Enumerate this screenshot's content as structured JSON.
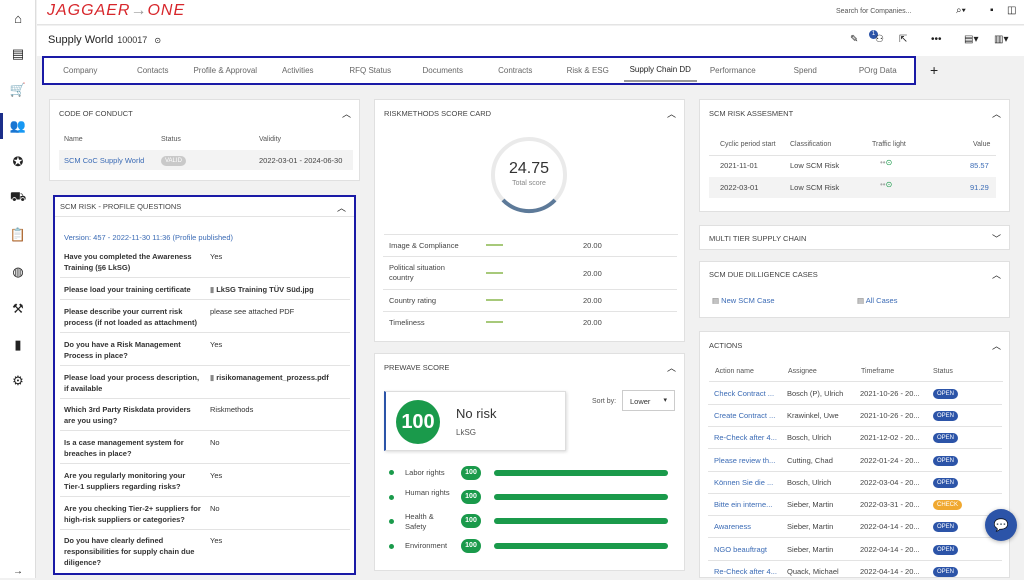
{
  "app": {
    "logo_left": "JAGGAER",
    "logo_right": "ONE"
  },
  "search": {
    "placeholder": "Search for Companies..."
  },
  "header": {
    "title": "Supply World",
    "id": "100017",
    "notif_count": "1"
  },
  "tabs": [
    {
      "label": "Company"
    },
    {
      "label": "Contacts"
    },
    {
      "label": "Profile & Approval"
    },
    {
      "label": "Activities"
    },
    {
      "label": "RFQ Status"
    },
    {
      "label": "Documents"
    },
    {
      "label": "Contracts"
    },
    {
      "label": "Risk & ESG"
    },
    {
      "label": "Supply Chain DD"
    },
    {
      "label": "Performance"
    },
    {
      "label": "Spend"
    },
    {
      "label": "POrg Data"
    }
  ],
  "conduct": {
    "title": "CODE OF CONDUCT",
    "cols": [
      "Name",
      "Status",
      "Validity"
    ],
    "row": {
      "name": "SCM CoC Supply World",
      "status": "VALID",
      "validity": "2022-03-01 - 2024-06-30"
    }
  },
  "profile": {
    "title": "SCM RISK - PROFILE QUESTIONS",
    "version": "Version: 457 - 2022-11-30 11:36 (Profile published)",
    "qa": [
      {
        "q": "Have you completed the Awareness Training (§6 LkSG)",
        "a": "Yes"
      },
      {
        "q": "Please load your training certificate",
        "a": "LkSG Training TÜV Süd.jpg"
      },
      {
        "q": "Please describe your current risk process (if not loaded as attachment)",
        "a": "please see attached PDF"
      },
      {
        "q": "Do you have a Risk Management Process in place?",
        "a": "Yes"
      },
      {
        "q": "Please load your process description, if available",
        "a": "risikomanagement_prozess.pdf"
      },
      {
        "q": "Which 3rd Party Riskdata providers are you using?",
        "a": "Riskmethods"
      },
      {
        "q": "Is a case management system for breaches in place?",
        "a": "No"
      },
      {
        "q": "Are you regularly monitoring your Tier-1 suppliers regarding risks?",
        "a": "Yes"
      },
      {
        "q": "Are you checking Tier-2+ suppliers for high-risk suppliers or categories?",
        "a": "No"
      },
      {
        "q": "Do you have clearly defined responsibilities for supply chain due diligence?",
        "a": "Yes"
      }
    ]
  },
  "riskmethods": {
    "title": "RISKMETHODS SCORE CARD",
    "score": "24.75",
    "score_label": "Total score",
    "rows": [
      {
        "label": "Image & Compliance",
        "value": "20.00"
      },
      {
        "label": "Political situation country",
        "value": "20.00"
      },
      {
        "label": "Country rating",
        "value": "20.00"
      },
      {
        "label": "Timeliness",
        "value": "20.00"
      }
    ]
  },
  "prewave": {
    "title": "PREWAVE SCORE",
    "score": "100",
    "risk": "No risk",
    "sub": "LkSG",
    "sort_label": "Sort by:",
    "sort_value": "Lower",
    "rows": [
      {
        "label": "Labor rights",
        "value": "100",
        "pct": 1.0
      },
      {
        "label": "Human rights",
        "value": "100",
        "pct": 1.0
      },
      {
        "label": "Health & Safety",
        "value": "100",
        "pct": 1.0
      },
      {
        "label": "Environment",
        "value": "100",
        "pct": 1.0
      }
    ]
  },
  "scm_risk": {
    "title": "SCM RISK ASSESMENT",
    "cols": [
      "Cyclic period start",
      "Classification",
      "Traffic light",
      "Value"
    ],
    "rows": [
      {
        "start": "2021-11-01",
        "class": "Low SCM Risk",
        "value": "85.57"
      },
      {
        "start": "2022-03-01",
        "class": "Low SCM Risk",
        "value": "91.29"
      }
    ]
  },
  "multitier": {
    "title": "MULTI TIER SUPPLY CHAIN"
  },
  "duecases": {
    "title": "SCM DUE DILLIGENCE CASES",
    "new": "New SCM Case",
    "all": "All Cases"
  },
  "actions": {
    "title": "ACTIONS",
    "cols": [
      "Action name",
      "Assignee",
      "Timeframe",
      "Status"
    ],
    "rows": [
      {
        "name": "Check Contract ...",
        "assignee": "Bosch (P), Ulrich",
        "time": "2021-10-26 - 20...",
        "status": "OPEN"
      },
      {
        "name": "Create Contract ...",
        "assignee": "Krawinkel, Uwe",
        "time": "2021-10-26 - 20...",
        "status": "OPEN"
      },
      {
        "name": "Re-Check after 4...",
        "assignee": "Bosch, Ulrich",
        "time": "2021-12-02 - 20...",
        "status": "OPEN"
      },
      {
        "name": "Please review th...",
        "assignee": "Cutting, Chad",
        "time": "2022-01-24 - 20...",
        "status": "OPEN"
      },
      {
        "name": "Können Sie die ...",
        "assignee": "Bosch, Ulrich",
        "time": "2022-03-04 - 20...",
        "status": "OPEN"
      },
      {
        "name": "Bitte ein interne...",
        "assignee": "Sieber, Martin",
        "time": "2022-03-31 - 20...",
        "status": "CHECK"
      },
      {
        "name": "Awareness",
        "assignee": "Sieber, Martin",
        "time": "2022-04-14 - 20...",
        "status": "OPEN"
      },
      {
        "name": "NGO beauftragt",
        "assignee": "Sieber, Martin",
        "time": "2022-04-14 - 20...",
        "status": "OPEN"
      },
      {
        "name": "Re-Check after 4...",
        "assignee": "Quack, Michael",
        "time": "2022-04-14 - 20...",
        "status": "OPEN"
      }
    ]
  },
  "colors": {
    "brand": "#d7262b",
    "highlight": "#1a1aa6",
    "green": "#1a9a4b",
    "open": "#2c54a8",
    "check": "#f0a830",
    "link": "#3b6bb5"
  }
}
